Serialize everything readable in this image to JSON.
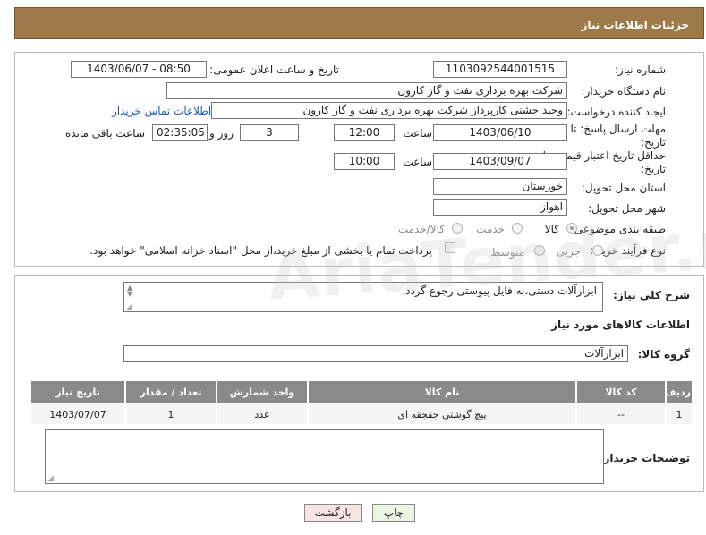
{
  "header": {
    "title": "جزئیات اطلاعات نیاز"
  },
  "fields": {
    "need_number": {
      "label": "شماره نیاز:",
      "value": "1103092544001515"
    },
    "announce_datetime": {
      "label": "تاریخ و ساعت اعلان عمومی:",
      "value": "1403/06/07 - 08:50"
    },
    "buyer_org": {
      "label": "نام دستگاه خریدار:",
      "value": "شرکت بهره برداری نفت و گاز کارون"
    },
    "requester": {
      "label": "ایجاد کننده درخواست:",
      "value": "وحید جشنی کارپرداز شرکت بهره برداری نفت و گاز کارون"
    },
    "buyer_contact_link": "اطلاعات تماس خریدار",
    "reply_deadline": {
      "label_line1": "مهلت ارسال پاسخ: تا",
      "label_line2": "تاریخ:",
      "date": "1403/06/10",
      "time_label": "ساعت",
      "time": "12:00",
      "days": "3",
      "days_label": "روز و",
      "remaining": "02:35:05",
      "remaining_label": "ساعت باقی مانده"
    },
    "price_validity": {
      "label_line1": "حداقل تاریخ اعتبار قیمت: تا",
      "label_line2": "تاریخ:",
      "date": "1403/09/07",
      "time_label": "ساعت",
      "time": "10:00"
    },
    "delivery_province": {
      "label": "استان محل تحویل:",
      "value": "خوزستان"
    },
    "delivery_city": {
      "label": "شهر محل تحویل:",
      "value": "اهواز"
    },
    "category": {
      "label": "طبقه بندی موضوعی:",
      "options": [
        "کالا",
        "خدمت",
        "کالا/خدمت"
      ],
      "selected": "کالا"
    },
    "process_type": {
      "label": "نوع فرآیند خرید :",
      "options": [
        "جزیی",
        "متوسط"
      ],
      "payment_note": "پرداخت تمام یا بخشی از مبلغ خرید،از محل \"اسناد خزانه اسلامی\" خواهد بود."
    }
  },
  "details": {
    "general_desc_label": "شرح کلی نیاز:",
    "general_desc_value": "ابزارآلات دستی،به فایل پیوستی رجوع گردد.",
    "goods_info_title": "اطلاعات کالاهای مورد نیاز",
    "goods_group_label": "گروه کالا:",
    "goods_group_value": "ابزارآلات",
    "table": {
      "headers": [
        "ردیف",
        "کد کالا",
        "نام کالا",
        "واحد شمارش",
        "تعداد / مقدار",
        "تاریخ نیاز"
      ],
      "rows": [
        [
          "1",
          "--",
          "پیچ گوشتی جقجقه ای",
          "عدد",
          "1",
          "1403/07/07"
        ]
      ]
    },
    "buyer_notes_label": "توضیحات خریدار:"
  },
  "buttons": {
    "print": "چاپ",
    "back": "بازگشت"
  },
  "watermark": "AriaTender.neT"
}
